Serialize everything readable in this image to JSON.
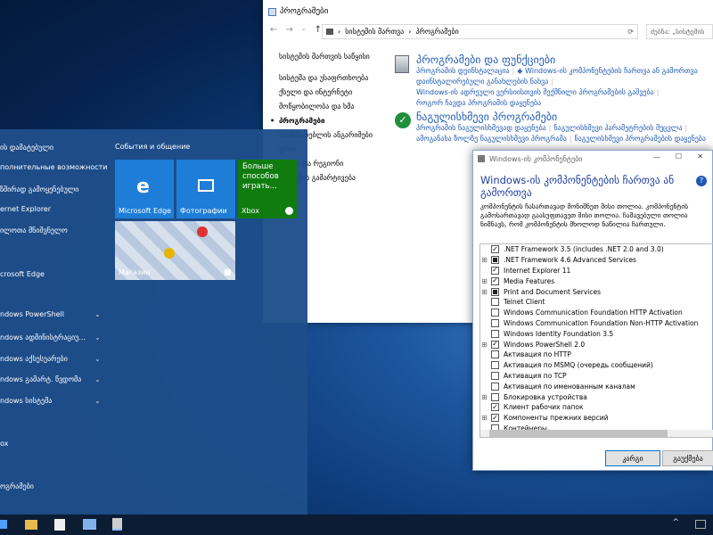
{
  "control_panel": {
    "window_title": "პროგრამები",
    "breadcrumb": [
      "სისტემის მართვა",
      "პროგრამები"
    ],
    "search_placeholder": "ძებნა: „სისტემის",
    "left_nav": [
      "სისტემის მართვის საწყისი",
      "სისტემა და უსაფრთხოება",
      "ქსელი და ინტერნეტი",
      "მოწყობილობა და ხმა",
      "პროგრამები",
      "მომხმარებლის ანგარიშები",
      "დრო",
      "საათი და რეგიონი",
      "სისტემის გამარტივება"
    ],
    "current_nav": "პროგრამები",
    "programs_section": {
      "heading": "პროგრამები და ფუნქციები",
      "links": [
        [
          "პროგრამის დეინსტალაცია",
          "Windows-ის კომპონენტების ჩართვა ან გამორთვა"
        ],
        [
          "დაინსტალირებული განახლების ნახვა"
        ],
        [
          "Windows-ის ადრეული ვერსიისთვის შექმნილი პროგრამების გაშვება"
        ],
        [
          "როგორ ჩავდა პროგრამის დაყენება"
        ]
      ]
    },
    "defaults_section": {
      "heading": "ნაგულისხმევი პროგრამები",
      "links": [
        [
          "პროგრამის ნაგულისხმევად დაყენება",
          "ნაგულისხმევი პარამეტრების შეცვლა"
        ],
        [
          "ამოგანახა ზოლზე ნაგულისხმევი პროგრამა",
          "ნაგულისხმევი პროგრამების დაყენება"
        ]
      ]
    }
  },
  "start_menu": {
    "left_items": [
      "ის დამატებული",
      "полнительные возможности",
      "ზშირად გამოყენებული",
      "ernet Explorer",
      "ილოთა მნიშვნელო",
      "crosoft Edge",
      "ndows PowerShell",
      "ndows ადმინისტრაციუ...",
      "ndows აქსესუარები",
      "ndows გამარტ. წვდომა",
      "ndows სისტემა",
      "ox",
      "ოგრამები"
    ],
    "group_title": "События и общение",
    "tiles": {
      "edge": "Microsoft Edge",
      "photos": "Фотографии",
      "xbox_text": "Больше способов играть...",
      "xbox": "Xbox",
      "store": "Магазин"
    }
  },
  "features_dialog": {
    "window_title": "Windows-ის კომპონენტები",
    "title": "Windows-ის კომპონენტების ჩართვა ან გამორთვა",
    "description": "კომპონენტის ჩასართავად მონიშნეთ მისი თოლია. კომპონენტის გამოსართავად გაასუფთავეთ მისი თოლია. ჩაშავებული თოლია ნიშნავს, რომ კომპონენტის მხოლოდ ნაწილია ჩართული.",
    "features": [
      {
        "label": ".NET Framework 3.5 (includes .NET 2.0 and 3.0)",
        "state": "checked",
        "expand": false
      },
      {
        "label": ".NET Framework 4.6 Advanced Services",
        "state": "partial",
        "expand": true
      },
      {
        "label": "Internet Explorer 11",
        "state": "checked",
        "expand": false
      },
      {
        "label": "Media Features",
        "state": "checked",
        "expand": true
      },
      {
        "label": "Print and Document Services",
        "state": "partial",
        "expand": true
      },
      {
        "label": "Telnet Client",
        "state": "none",
        "expand": false
      },
      {
        "label": "Windows Communication Foundation HTTP Activation",
        "state": "none",
        "expand": false
      },
      {
        "label": "Windows Communication Foundation Non-HTTP Activation",
        "state": "none",
        "expand": false
      },
      {
        "label": "Windows Identity Foundation 3.5",
        "state": "none",
        "expand": false
      },
      {
        "label": "Windows PowerShell 2.0",
        "state": "checked",
        "expand": true
      },
      {
        "label": "Активация по HTTP",
        "state": "none",
        "expand": false
      },
      {
        "label": "Активация по MSMQ (очередь сообщений)",
        "state": "none",
        "expand": false
      },
      {
        "label": "Активация по TCP",
        "state": "none",
        "expand": false
      },
      {
        "label": "Активация по именованным каналам",
        "state": "none",
        "expand": false
      },
      {
        "label": "Блокировка устройства",
        "state": "none",
        "expand": true
      },
      {
        "label": "Клиент рабочих папок",
        "state": "checked",
        "expand": false
      },
      {
        "label": "Компоненты прежних версий",
        "state": "checked",
        "expand": true
      },
      {
        "label": "Контейнеры",
        "state": "none",
        "expand": false
      }
    ],
    "ok": "კარგი",
    "cancel": "გაუქმება"
  },
  "colors": {
    "accent": "#1e5ab4",
    "start_menu": "#1e4e8a",
    "tile": "#1e7dd7",
    "xbox": "#107c10"
  },
  "taskbar_icons": [
    "windows-icon",
    "edge-icon",
    "explorer-icon",
    "store-icon",
    "control-panel-icon",
    "features-icon"
  ]
}
